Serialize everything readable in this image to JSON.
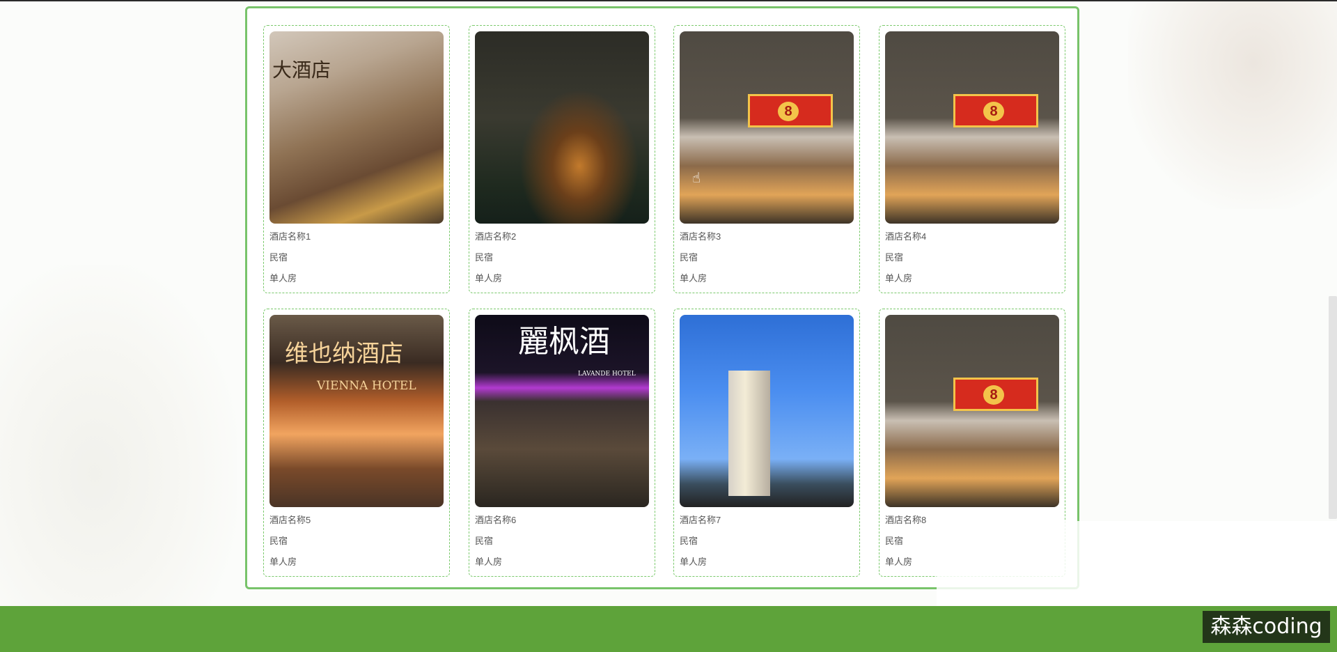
{
  "hotels": [
    {
      "name": "酒店名称1",
      "type": "民宿",
      "room": "单人房"
    },
    {
      "name": "酒店名称2",
      "type": "民宿",
      "room": "单人房"
    },
    {
      "name": "酒店名称3",
      "type": "民宿",
      "room": "单人房"
    },
    {
      "name": "酒店名称4",
      "type": "民宿",
      "room": "单人房"
    },
    {
      "name": "酒店名称5",
      "type": "民宿",
      "room": "单人房"
    },
    {
      "name": "酒店名称6",
      "type": "民宿",
      "room": "单人房"
    },
    {
      "name": "酒店名称7",
      "type": "民宿",
      "room": "单人房"
    },
    {
      "name": "酒店名称8",
      "type": "民宿",
      "room": "单人房"
    }
  ],
  "photo_signs": {
    "hotel1": "大酒店",
    "hotel5": "维也纳酒店",
    "hotel5_sub": "VIENNA HOTEL",
    "hotel6": "麗枫酒",
    "hotel6_sub": "LAVANDE HOTEL"
  },
  "watermark": "森森coding",
  "colors": {
    "accent_green": "#78c36a",
    "footer_green": "#5ea33a"
  }
}
